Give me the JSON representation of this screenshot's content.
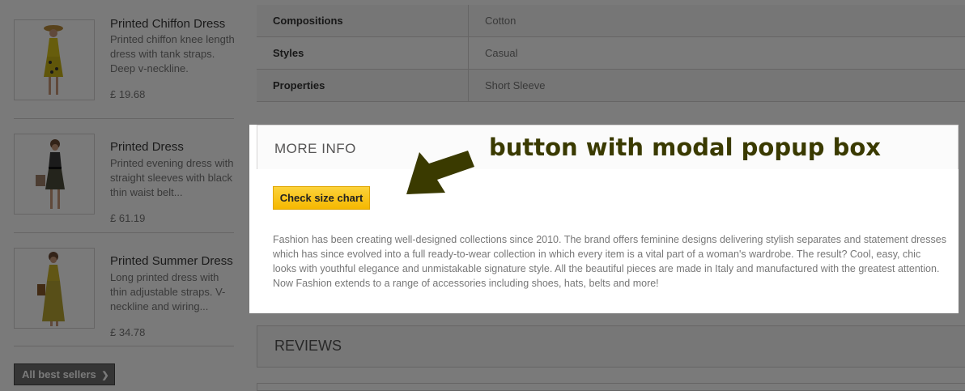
{
  "sidebar": {
    "products": [
      {
        "name": "Printed Chiffon Dress",
        "description": "Printed chiffon knee length dress with tank straps. Deep v-neckline.",
        "price": "£ 19.68"
      },
      {
        "name": "Printed Dress",
        "description": "Printed evening dress with straight sleeves with black thin waist belt...",
        "price": "£ 61.19"
      },
      {
        "name": "Printed Summer Dress",
        "description": "Long printed dress with thin adjustable straps. V-neckline and wiring...",
        "price": "£ 34.78"
      }
    ],
    "all_best_sellers_label": "All best sellers",
    "chevron_glyph": "❯"
  },
  "datasheet": {
    "rows": [
      {
        "label": "Compositions",
        "value": "Cotton"
      },
      {
        "label": "Styles",
        "value": "Casual"
      },
      {
        "label": "Properties",
        "value": "Short Sleeve"
      }
    ]
  },
  "more_info": {
    "title": "MORE INFO",
    "button_label": "Check size chart",
    "description": "Fashion has been creating well-designed collections since 2010. The brand offers feminine designs delivering stylish separates and statement dresses which has since evolved into a full ready-to-wear collection in which every item is a vital part of a woman's wardrobe. The result? Cool, easy, chic looks with youthful elegance and unmistakable signature style. All the beautiful pieces are made in Italy and manufactured with the greatest attention. Now Fashion extends to a range of accessories including shoes, hats, belts and more!",
    "annotation": "button with modal popup box"
  },
  "reviews": {
    "title": "REVIEWS"
  },
  "colors": {
    "button_yellow": "#f8c51a",
    "annotation": "#3a3a00",
    "overlay": "#000000"
  }
}
